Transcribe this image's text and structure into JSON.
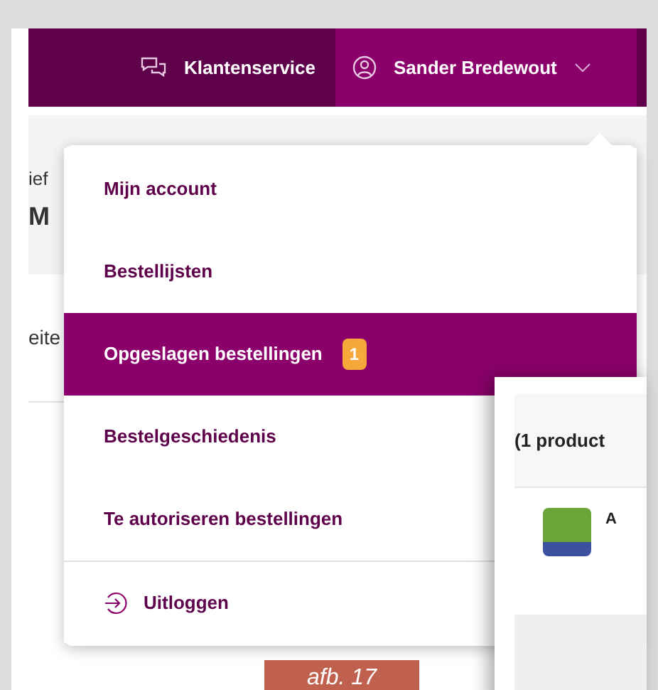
{
  "header": {
    "service_link": {
      "label": "Klantenservice"
    },
    "user_menu": {
      "label": "Sander Bredewout",
      "expanded": true
    }
  },
  "background_texts": [
    "ief",
    "M",
    "eite"
  ],
  "menu": {
    "items": [
      {
        "kind": "link",
        "label": "Mijn account",
        "selected": false
      },
      {
        "kind": "link",
        "label": "Bestellijsten",
        "selected": false
      },
      {
        "kind": "link",
        "label": "Opgeslagen bestellingen",
        "selected": true,
        "badge": "1"
      },
      {
        "kind": "link",
        "label": "Bestelgeschiedenis",
        "selected": false
      },
      {
        "kind": "link",
        "label": "Te autoriseren bestellingen",
        "selected": false
      },
      {
        "kind": "logout",
        "label": "Uitloggen",
        "selected": false
      }
    ]
  },
  "cart_panel": {
    "title": "(1 product",
    "row_text": "A"
  },
  "figure_label": "afb. 17"
}
